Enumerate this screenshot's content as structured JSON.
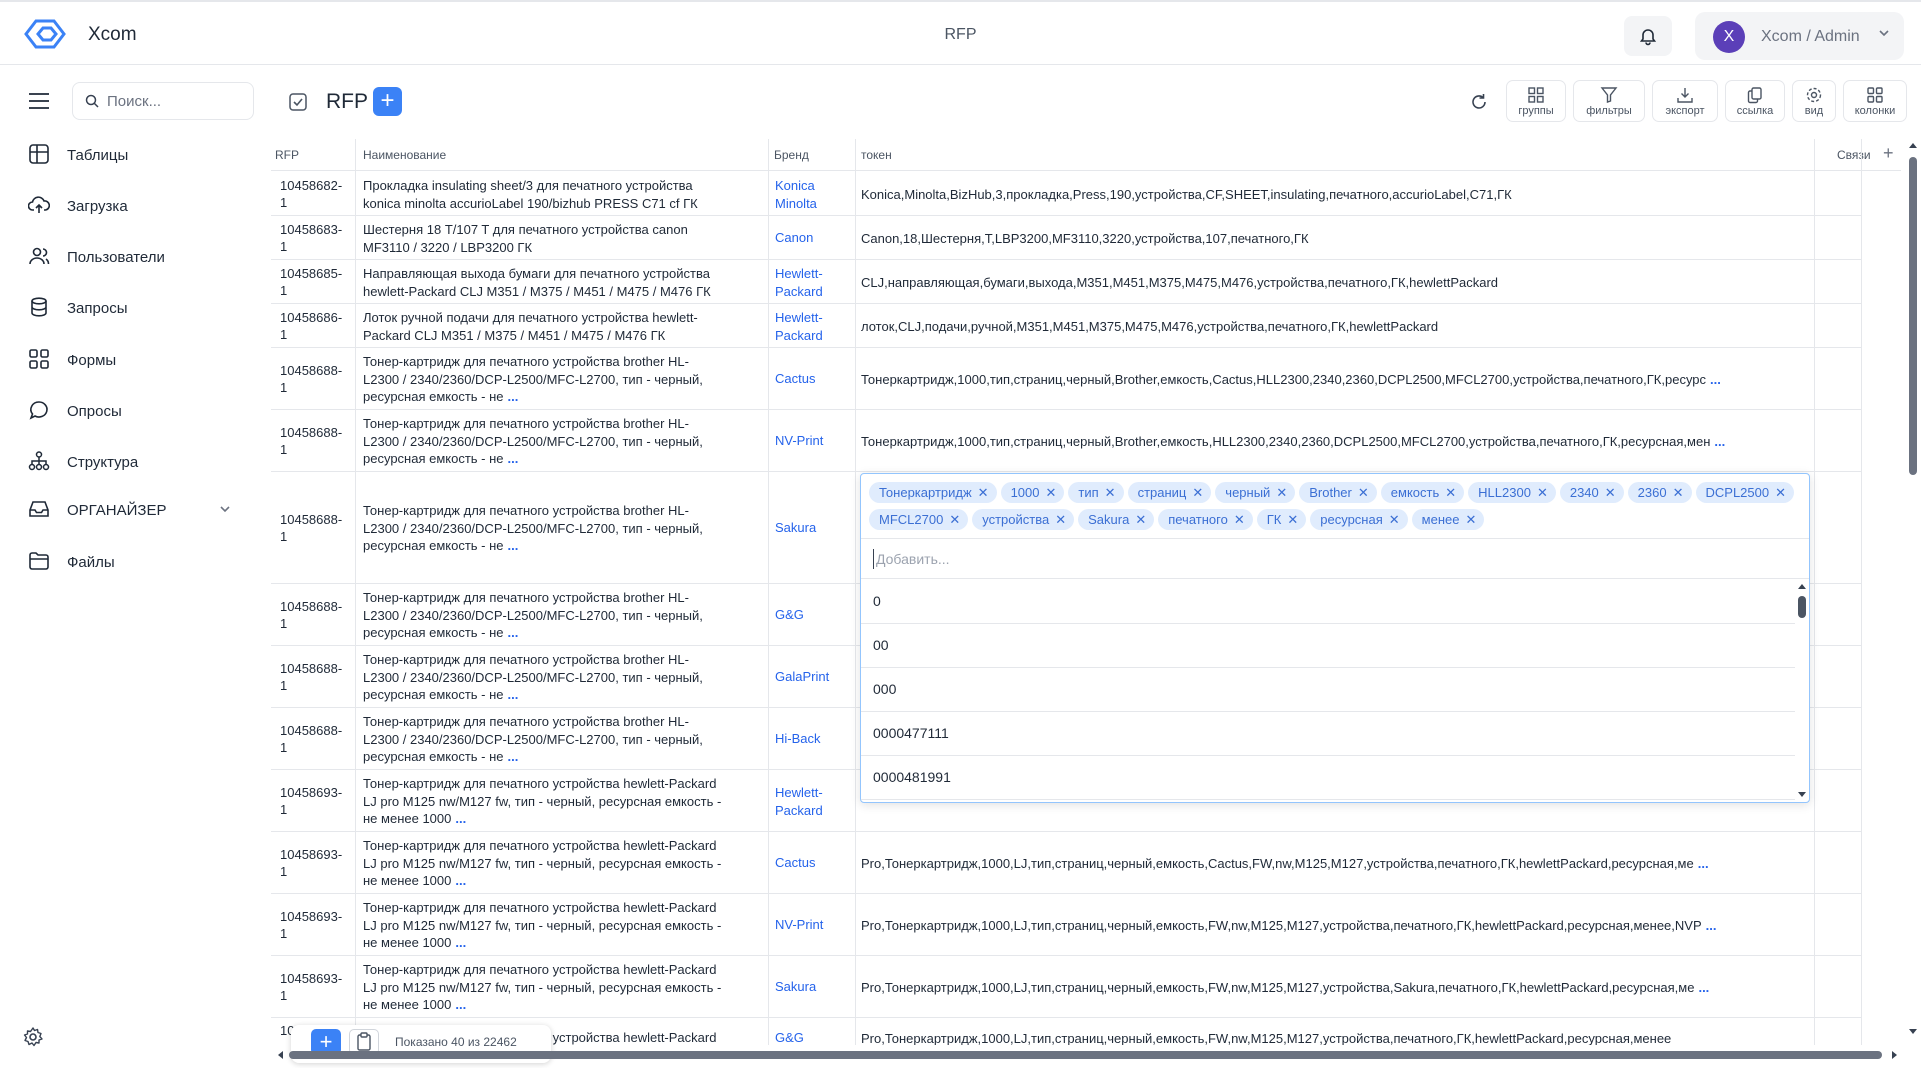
{
  "app": {
    "brand": "Xcom",
    "page_title": "RFP",
    "user": "Xcom / Admin",
    "avatar_letter": "X"
  },
  "sidebar": {
    "search_placeholder": "Поиск...",
    "items": [
      {
        "label": "Таблицы",
        "icon": "table-icon"
      },
      {
        "label": "Загрузка",
        "icon": "upload-icon"
      },
      {
        "label": "Пользователи",
        "icon": "users-icon"
      },
      {
        "label": "Запросы",
        "icon": "database-icon"
      },
      {
        "label": "Формы",
        "icon": "forms-icon"
      },
      {
        "label": "Опросы",
        "icon": "chat-icon"
      },
      {
        "label": "Структура",
        "icon": "structure-icon"
      },
      {
        "label": "ОРГАНАЙЗЕР",
        "icon": "inbox-icon"
      },
      {
        "label": "Файлы",
        "icon": "folder-icon"
      }
    ]
  },
  "content": {
    "title": "RFP",
    "toolbar": [
      "группы",
      "фильтры",
      "экспорт",
      "ссылка",
      "вид",
      "колонки"
    ]
  },
  "table": {
    "headers": {
      "rfp": "RFP",
      "name": "Наименование",
      "brand": "Бренд",
      "token": "токен",
      "links": "Связи"
    },
    "rows": [
      {
        "rfp": [
          "10458682-",
          "1"
        ],
        "name": [
          "Прокладка insulating sheet/3 для печатного устройства",
          "konica minolta accurioLabel 190/bizhub PRESS C71 cf ГК"
        ],
        "brand": [
          "Konica",
          "Minolta"
        ],
        "token": "Konica,Minolta,BizHub,3,прокладка,Press,190,устройства,CF,SHEET,insulating,печатного,accurioLabel,C71,ГК",
        "more": false
      },
      {
        "rfp": [
          "10458683-",
          "1"
        ],
        "name": [
          "Шестерня 18 T/107 T для печатного устройства canon",
          "MF3110 / 3220 / LBP3200 ГК"
        ],
        "brand": [
          "Canon"
        ],
        "token": "Canon,18,Шестерня,T,LBP3200,MF3110,3220,устройства,107,печатного,ГК",
        "more": false
      },
      {
        "rfp": [
          "10458685-",
          "1"
        ],
        "name": [
          "Направляющая выхода бумаги для печатного устройства",
          "hewlett-Packard CLJ M351 / M375 / M451 / M475 / M476 ГК"
        ],
        "brand": [
          "Hewlett-",
          "Packard"
        ],
        "token": "CLJ,направляющая,бумаги,выхода,M351,M451,M375,M475,M476,устройства,печатного,ГК,hewlettPackard",
        "more": false
      },
      {
        "rfp": [
          "10458686-",
          "1"
        ],
        "name": [
          "Лоток ручной подачи для печатного устройства hewlett-",
          "Packard CLJ M351 / M375 / M451 / M475 / M476 ГК"
        ],
        "brand": [
          "Hewlett-",
          "Packard"
        ],
        "token": "лоток,CLJ,подачи,ручной,M351,M451,M375,M475,M476,устройства,печатного,ГК,hewlettPackard",
        "more": false
      },
      {
        "rfp": [
          "10458688-",
          "1"
        ],
        "name": [
          "Тонер-картридж для печатного устройства brother HL-",
          "L2300 / 2340/2360/DCP-L2500/MFC-L2700, тип - черный,",
          "ресурсная емкость - не"
        ],
        "brand": [
          "Cactus"
        ],
        "token": "Тонеркартридж,1000,тип,страниц,черный,Brother,емкость,Cactus,HLL2300,2340,2360,DCPL2500,MFCL2700,устройства,печатного,ГК,ресурс",
        "more": true
      },
      {
        "rfp": [
          "10458688-",
          "1"
        ],
        "name": [
          "Тонер-картридж для печатного устройства brother HL-",
          "L2300 / 2340/2360/DCP-L2500/MFC-L2700, тип - черный,",
          "ресурсная емкость - не"
        ],
        "brand": [
          "NV-Print"
        ],
        "token": "Тонеркартридж,1000,тип,страниц,черный,Brother,емкость,HLL2300,2340,2360,DCPL2500,MFCL2700,устройства,печатного,ГК,ресурсная,мен",
        "more": true
      },
      {
        "rfp": [
          "10458688-",
          "1"
        ],
        "name": [
          "Тонер-картридж для печатного устройства brother HL-",
          "L2300 / 2340/2360/DCP-L2500/MFC-L2700, тип - черный,",
          "ресурсная емкость - не"
        ],
        "brand": [
          "Sakura"
        ],
        "token": "",
        "more": false
      },
      {
        "rfp": [
          "10458688-",
          "1"
        ],
        "name": [
          "Тонер-картридж для печатного устройства brother HL-",
          "L2300 / 2340/2360/DCP-L2500/MFC-L2700, тип - черный,",
          "ресурсная емкость - не"
        ],
        "brand": [
          "G&G"
        ],
        "token": "",
        "more": false
      },
      {
        "rfp": [
          "10458688-",
          "1"
        ],
        "name": [
          "Тонер-картридж для печатного устройства brother HL-",
          "L2300 / 2340/2360/DCP-L2500/MFC-L2700, тип - черный,",
          "ресурсная емкость - не"
        ],
        "brand": [
          "GalaPrint"
        ],
        "token": "",
        "more": false
      },
      {
        "rfp": [
          "10458688-",
          "1"
        ],
        "name": [
          "Тонер-картридж для печатного устройства brother HL-",
          "L2300 / 2340/2360/DCP-L2500/MFC-L2700, тип - черный,",
          "ресурсная емкость - не"
        ],
        "brand": [
          "Hi-Back"
        ],
        "token": "",
        "more": false
      },
      {
        "rfp": [
          "10458693-",
          "1"
        ],
        "name": [
          "Тонер-картридж для печатного устройства hewlett-Packard",
          "LJ pro M125 nw/M127 fw, тип - черный, ресурсная емкость -",
          "не менее 1000"
        ],
        "brand": [
          "Hewlett-",
          "Packard"
        ],
        "token": "",
        "more": false
      },
      {
        "rfp": [
          "10458693-",
          "1"
        ],
        "name": [
          "Тонер-картридж для печатного устройства hewlett-Packard",
          "LJ pro M125 nw/M127 fw, тип - черный, ресурсная емкость -",
          "не менее 1000"
        ],
        "brand": [
          "Cactus"
        ],
        "token": "Pro,Тонеркартридж,1000,LJ,тип,страниц,черный,емкость,Cactus,FW,nw,M125,M127,устройства,печатного,ГК,hewlettPackard,ресурсная,ме",
        "more": true
      },
      {
        "rfp": [
          "10458693-",
          "1"
        ],
        "name": [
          "Тонер-картридж для печатного устройства hewlett-Packard",
          "LJ pro M125 nw/M127 fw, тип - черный, ресурсная емкость -",
          "не менее 1000"
        ],
        "brand": [
          "NV-Print"
        ],
        "token": "Pro,Тонеркартридж,1000,LJ,тип,страниц,черный,емкость,FW,nw,M125,M127,устройства,печатного,ГК,hewlettPackard,ресурсная,менее,NVP",
        "more": true
      },
      {
        "rfp": [
          "10458693-",
          "1"
        ],
        "name": [
          "Тонер-картридж для печатного устройства hewlett-Packard",
          "LJ pro M125 nw/M127 fw, тип - черный, ресурсная емкость -",
          "не менее 1000"
        ],
        "brand": [
          "Sakura"
        ],
        "token": "Pro,Тонеркартридж,1000,LJ,тип,страниц,черный,емкость,FW,nw,M125,M127,устройства,Sakura,печатного,ГК,hewlettPackard,ресурсная,ме",
        "more": true
      },
      {
        "rfp": [
          "10",
          ""
        ],
        "name": [
          "Тонер-картридж для печатного устройства hewlett-Packard"
        ],
        "brand": [
          "G&G"
        ],
        "token": "Pro,Тонеркартридж,1000,LJ,тип,страниц,черный,емкость,FW,nw,M125,M127,устройства,печатного,ГК,hewlettPackard,ресурсная,менее",
        "more": false
      }
    ],
    "more_label": "..."
  },
  "editor": {
    "chips": [
      "Тонеркартридж",
      "1000",
      "тип",
      "страниц",
      "черный",
      "Brother",
      "емкость",
      "HLL2300",
      "2340",
      "2360",
      "DCPL2500",
      "MFCL2700",
      "устройства",
      "Sakura",
      "печатного",
      "ГК",
      "ресурсная",
      "менее"
    ],
    "input_placeholder": "Добавить...",
    "options": [
      "0",
      "00",
      "000",
      "0000477111",
      "0000481991"
    ]
  },
  "footer": {
    "status": "Показано 40 из 22462"
  },
  "colors": {
    "accent": "#3b82f6",
    "link": "#2563eb",
    "avatar": "#5b3fb8",
    "chip_bg": "#e0ecfd"
  }
}
